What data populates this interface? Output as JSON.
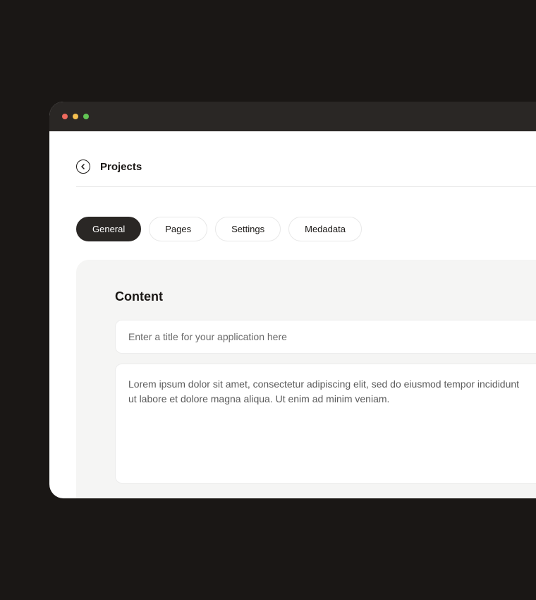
{
  "header": {
    "title": "Projects"
  },
  "tabs": [
    {
      "label": "General",
      "active": true
    },
    {
      "label": "Pages",
      "active": false
    },
    {
      "label": "Settings",
      "active": false
    },
    {
      "label": "Medadata",
      "active": false
    }
  ],
  "panel": {
    "title": "Content",
    "title_input": {
      "placeholder": "Enter a title for your application here"
    },
    "description_input": {
      "value": "Lorem ipsum dolor sit amet, consectetur adipiscing elit, sed do eiusmod tempor incididunt ut labore et dolore magna aliqua. Ut enim ad minim veniam."
    }
  }
}
